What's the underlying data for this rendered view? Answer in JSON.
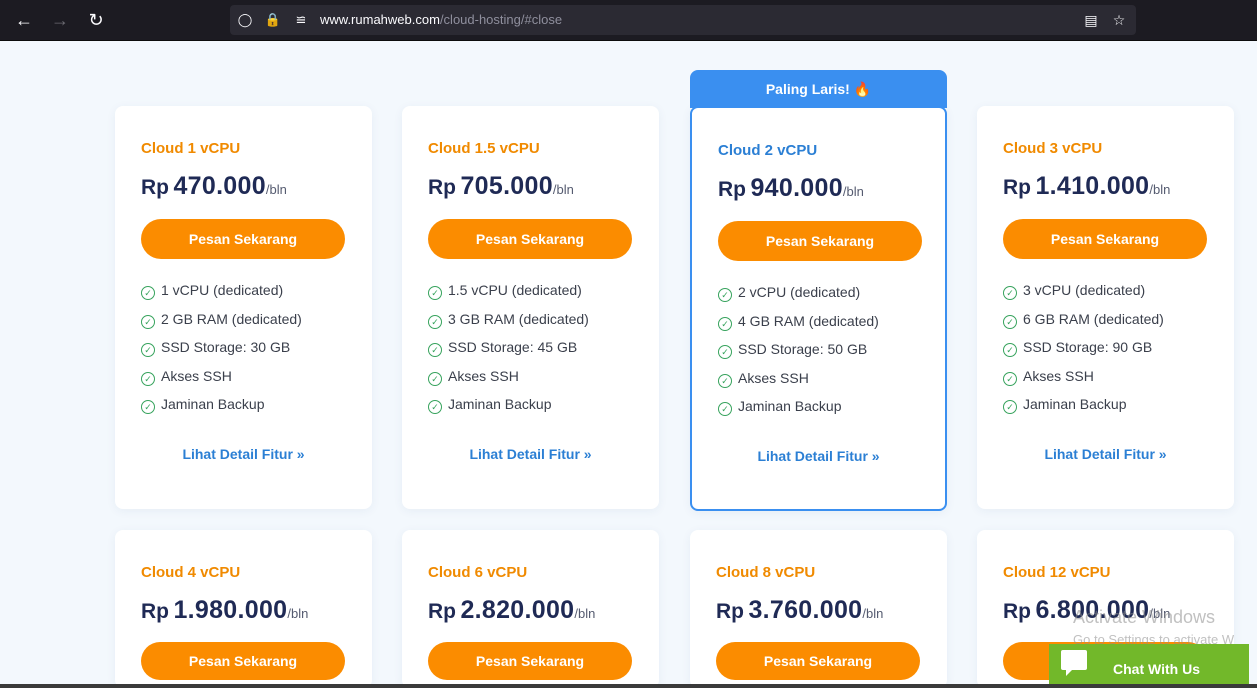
{
  "browser": {
    "url_host": "www.rumahweb.com",
    "url_path": "/cloud-hosting/#close"
  },
  "plans": [
    {
      "name": "Cloud 1 vCPU",
      "currency": "Rp",
      "price": "470.000",
      "period": "/bln",
      "button": "Pesan Sekarang",
      "features": [
        "1 vCPU (dedicated)",
        "2 GB RAM (dedicated)",
        "SSD Storage: 30 GB",
        "Akses SSH",
        "Jaminan Backup"
      ],
      "detail": "Lihat Detail Fitur »"
    },
    {
      "name": "Cloud 1.5 vCPU",
      "currency": "Rp",
      "price": "705.000",
      "period": "/bln",
      "button": "Pesan Sekarang",
      "features": [
        "1.5 vCPU (dedicated)",
        "3 GB RAM (dedicated)",
        "SSD Storage: 45 GB",
        "Akses SSH",
        "Jaminan Backup"
      ],
      "detail": "Lihat Detail Fitur »"
    },
    {
      "name": "Cloud 2 vCPU",
      "currency": "Rp",
      "price": "940.000",
      "period": "/bln",
      "button": "Pesan Sekarang",
      "badge": "Paling Laris! 🔥",
      "features": [
        "2 vCPU (dedicated)",
        "4 GB RAM (dedicated)",
        "SSD Storage: 50 GB",
        "Akses SSH",
        "Jaminan Backup"
      ],
      "detail": "Lihat Detail Fitur »"
    },
    {
      "name": "Cloud 3 vCPU",
      "currency": "Rp",
      "price": "1.410.000",
      "period": "/bln",
      "button": "Pesan Sekarang",
      "features": [
        "3 vCPU (dedicated)",
        "6 GB RAM (dedicated)",
        "SSD Storage: 90 GB",
        "Akses SSH",
        "Jaminan Backup"
      ],
      "detail": "Lihat Detail Fitur »"
    },
    {
      "name": "Cloud 4 vCPU",
      "currency": "Rp",
      "price": "1.980.000",
      "period": "/bln",
      "button": "Pesan Sekarang"
    },
    {
      "name": "Cloud 6 vCPU",
      "currency": "Rp",
      "price": "2.820.000",
      "period": "/bln",
      "button": "Pesan Sekarang"
    },
    {
      "name": "Cloud 8 vCPU",
      "currency": "Rp",
      "price": "3.760.000",
      "period": "/bln",
      "button": "Pesan Sekarang"
    },
    {
      "name": "Cloud 12 vCPU",
      "currency": "Rp",
      "price": "6.800.000",
      "period": "/bln",
      "button": "Pesan Sekarang"
    }
  ],
  "watermark": {
    "line1": "Activate Windows",
    "line2": "Go to Settings to activate W"
  },
  "chat": {
    "label": "Chat With Us"
  }
}
